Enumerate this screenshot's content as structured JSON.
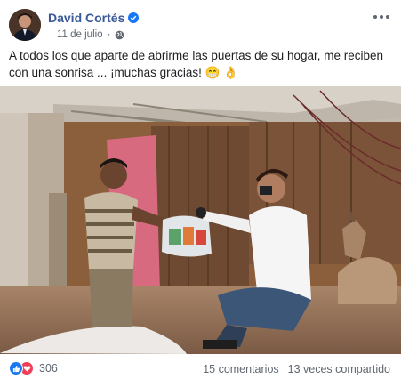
{
  "post": {
    "author": "David Cortés",
    "date": "11 de julio",
    "separator": "·",
    "text": "A todos los que aparte de abrirme las puertas de su hogar, me reciben con una sonrisa ... ¡muchas gracias! 😁 👌",
    "reaction_count": "306",
    "comments": "15 comentarios",
    "shares": "13 veces compartido"
  },
  "colors": {
    "author_link": "#385898",
    "like_blue": "#1877f2",
    "love_red": "#f33e58",
    "muted_text": "#606770"
  },
  "icons": {
    "verified": "verified-badge-icon",
    "privacy": "globe-icon",
    "more": "more-options-icon",
    "like": "like-icon",
    "love": "love-icon"
  }
}
